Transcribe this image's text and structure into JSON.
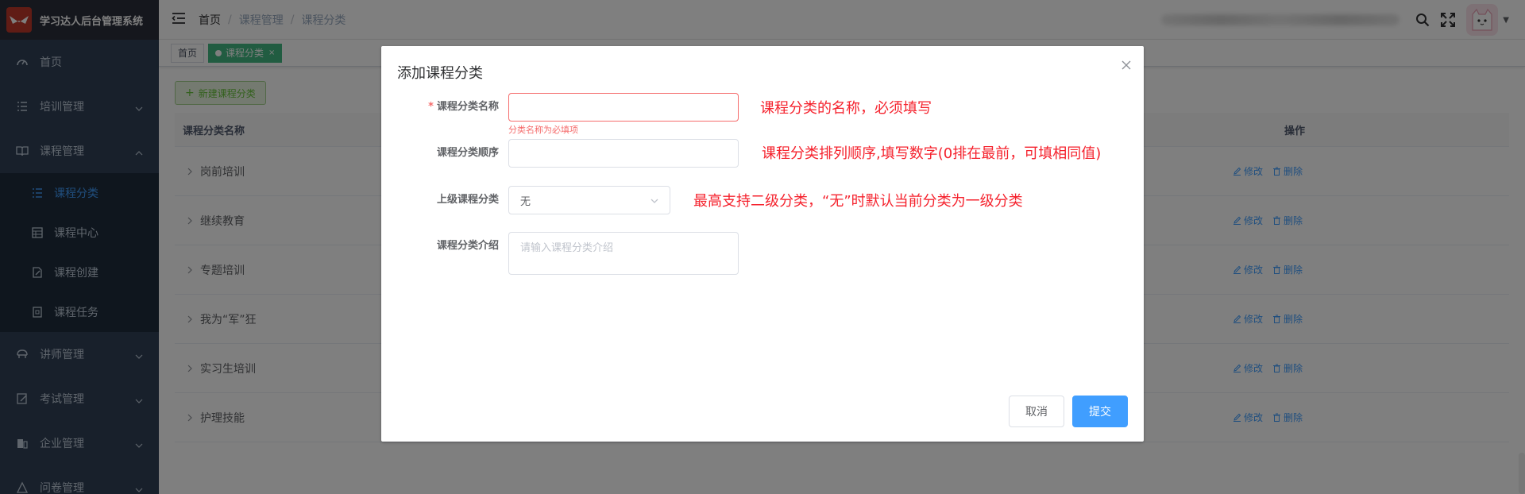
{
  "app": {
    "title": "学习达人后台管理系统"
  },
  "sidebar": {
    "items": [
      {
        "label": "首页",
        "icon": "dashboard-icon"
      },
      {
        "label": "培训管理",
        "icon": "list-icon"
      },
      {
        "label": "课程管理",
        "icon": "book-icon",
        "expanded": true,
        "children": [
          {
            "label": "课程分类",
            "icon": "list-icon",
            "active": true
          },
          {
            "label": "课程中心",
            "icon": "table-icon"
          },
          {
            "label": "课程创建",
            "icon": "edit-doc-icon"
          },
          {
            "label": "课程任务",
            "icon": "task-icon"
          }
        ]
      },
      {
        "label": "讲师管理",
        "icon": "teacher-icon"
      },
      {
        "label": "考试管理",
        "icon": "exam-icon"
      },
      {
        "label": "企业管理",
        "icon": "company-icon"
      },
      {
        "label": "问卷管理",
        "icon": "survey-icon"
      }
    ]
  },
  "breadcrumb": [
    "首页",
    "课程管理",
    "课程分类"
  ],
  "tags": [
    {
      "label": "首页",
      "active": false
    },
    {
      "label": "课程分类",
      "active": true,
      "close": "×"
    }
  ],
  "toolbar": {
    "add_label": "新建课程分类"
  },
  "table": {
    "columns": {
      "name": "课程分类名称",
      "ops": "操作"
    },
    "rows": [
      "岗前培训",
      "继续教育",
      "专题培训",
      "我为“军”狂",
      "实习生培训",
      "护理技能"
    ],
    "edit_label": "修改",
    "delete_label": "删除"
  },
  "dialog": {
    "title": "添加课程分类",
    "close": "×",
    "fields": {
      "name": {
        "label": "课程分类名称",
        "required_mark": "*",
        "value": "",
        "error": "分类名称为必填项"
      },
      "order": {
        "label": "课程分类顺序",
        "value": ""
      },
      "parent": {
        "label": "上级课程分类",
        "value": "无"
      },
      "intro": {
        "label": "课程分类介绍",
        "placeholder": "请输入课程分类介绍"
      }
    },
    "annotations": {
      "name": "课程分类的名称，必须填写",
      "order": "课程分类排列顺序,填写数字(0排在最前，可填相同值)",
      "parent": "最高支持二级分类，“无”时默认当前分类为一级分类"
    },
    "cancel_label": "取消",
    "submit_label": "提交"
  },
  "colors": {
    "primary": "#409eff",
    "success": "#67c23a",
    "danger": "#f56c6c",
    "annotation": "#f5222d",
    "sidebar": "#304156"
  }
}
